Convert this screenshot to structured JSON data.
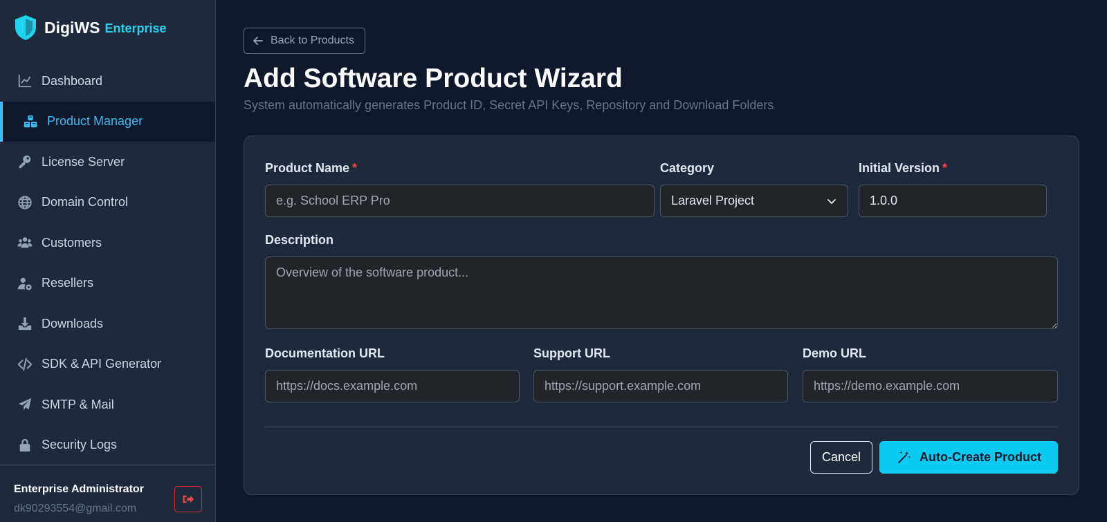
{
  "brand": {
    "name": "DigiWS",
    "edition": "Enterprise"
  },
  "sidebar": {
    "items": [
      {
        "label": "Dashboard",
        "icon": "chart-line-icon"
      },
      {
        "label": "Product Manager",
        "icon": "cubes-icon",
        "active": true
      },
      {
        "label": "License Server",
        "icon": "key-icon"
      },
      {
        "label": "Domain Control",
        "icon": "globe-icon"
      },
      {
        "label": "Customers",
        "icon": "users-icon"
      },
      {
        "label": "Resellers",
        "icon": "user-gear-icon"
      },
      {
        "label": "Downloads",
        "icon": "download-icon"
      },
      {
        "label": "SDK & API Generator",
        "icon": "code-icon"
      },
      {
        "label": "SMTP & Mail",
        "icon": "paper-plane-icon"
      },
      {
        "label": "Security Logs",
        "icon": "lock-icon"
      }
    ]
  },
  "user": {
    "name": "Enterprise Administrator",
    "email": "dk90293554@gmail.com",
    "logout_icon": "logout-icon"
  },
  "header": {
    "back_label": "Back to Products",
    "title": "Add Software Product Wizard",
    "subtitle": "System automatically generates Product ID, Secret API Keys, Repository and Download Folders"
  },
  "form": {
    "product_name": {
      "label": "Product Name",
      "required_mark": "*",
      "placeholder": "e.g. School ERP Pro",
      "value": ""
    },
    "category": {
      "label": "Category",
      "value": "Laravel Project"
    },
    "initial_version": {
      "label": "Initial Version",
      "required_mark": "*",
      "value": "1.0.0"
    },
    "description": {
      "label": "Description",
      "placeholder": "Overview of the software product...",
      "value": ""
    },
    "documentation_url": {
      "label": "Documentation URL",
      "placeholder": "https://docs.example.com"
    },
    "support_url": {
      "label": "Support URL",
      "placeholder": "https://support.example.com"
    },
    "demo_url": {
      "label": "Demo URL",
      "placeholder": "https://demo.example.com"
    },
    "cancel_label": "Cancel",
    "submit_label": "Auto-Create Product"
  },
  "colors": {
    "accent": "#0dcaf0",
    "active_nav": "#38bdf8",
    "danger": "#ef4444",
    "background": "#0f172a",
    "panel": "#1e293b"
  }
}
